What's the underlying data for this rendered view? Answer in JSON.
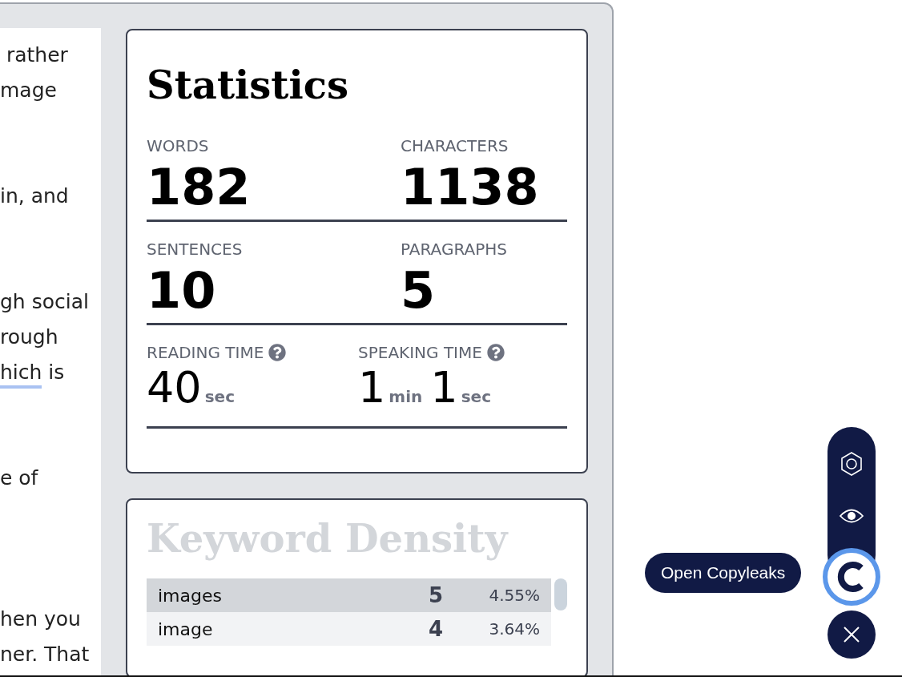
{
  "editor": {
    "lines": [
      {
        "kind": "text",
        "segments": [
          {
            "text": " rather",
            "underlined": false
          }
        ]
      },
      {
        "kind": "text",
        "segments": [
          {
            "text": "mage",
            "underlined": false
          }
        ]
      },
      {
        "kind": "blank"
      },
      {
        "kind": "blank"
      },
      {
        "kind": "text",
        "segments": [
          {
            "text": "in, and",
            "underlined": false
          }
        ]
      },
      {
        "kind": "blank"
      },
      {
        "kind": "blank"
      },
      {
        "kind": "text",
        "segments": [
          {
            "text": "gh social",
            "underlined": false
          }
        ]
      },
      {
        "kind": "text",
        "segments": [
          {
            "text": "rough",
            "underlined": false
          }
        ]
      },
      {
        "kind": "text",
        "segments": [
          {
            "text": "hich",
            "underlined": true
          },
          {
            "text": " is",
            "underlined": false
          }
        ]
      },
      {
        "kind": "blank"
      },
      {
        "kind": "blank"
      },
      {
        "kind": "text",
        "segments": [
          {
            "text": "e of",
            "underlined": false
          }
        ]
      },
      {
        "kind": "blank"
      },
      {
        "kind": "blank"
      },
      {
        "kind": "blank"
      },
      {
        "kind": "text",
        "segments": [
          {
            "text": "hen you",
            "underlined": false
          }
        ]
      },
      {
        "kind": "text",
        "segments": [
          {
            "text": "ner. That",
            "underlined": false
          }
        ]
      }
    ]
  },
  "statistics": {
    "title": "Statistics",
    "counts": [
      {
        "label": "WORDS",
        "value": "182"
      },
      {
        "label": "CHARACTERS",
        "value": "1138"
      },
      {
        "label": "SENTENCES",
        "value": "10"
      },
      {
        "label": "PARAGRAPHS",
        "value": "5"
      }
    ],
    "times": [
      {
        "label": "READING TIME",
        "parts": [
          {
            "number": "40",
            "unit": "sec"
          }
        ]
      },
      {
        "label": "SPEAKING TIME",
        "parts": [
          {
            "number": "1",
            "unit": "min"
          },
          {
            "number": "1",
            "unit": "sec"
          }
        ]
      }
    ]
  },
  "keyword_density": {
    "title": "Keyword Density",
    "rows": [
      {
        "keyword": "images",
        "count": "5",
        "percent": "4.55%",
        "selected": true
      },
      {
        "keyword": "image",
        "count": "4",
        "percent": "3.64%",
        "selected": false
      }
    ]
  },
  "widget": {
    "tooltip": "Open Copyleaks",
    "actions": [
      {
        "kind": "hexagon"
      },
      {
        "kind": "eye"
      }
    ]
  }
}
